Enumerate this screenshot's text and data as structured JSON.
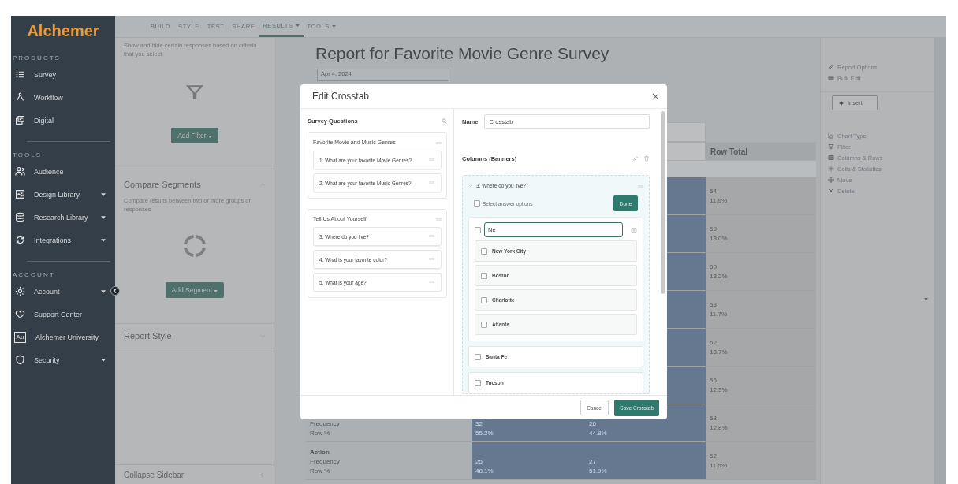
{
  "sidebar": {
    "logo": "Alchemer",
    "sections": [
      {
        "title": "PRODUCTS",
        "items": [
          {
            "label": "Survey",
            "kind": "list",
            "has_menu": false
          },
          {
            "label": "Workflow",
            "kind": "nodes",
            "has_menu": false
          },
          {
            "label": "Digital",
            "kind": "windows",
            "has_menu": false
          }
        ]
      },
      {
        "title": "TOOLS",
        "items": [
          {
            "label": "Audience",
            "kind": "people",
            "has_menu": false
          },
          {
            "label": "Design Library",
            "kind": "image",
            "has_menu": true
          },
          {
            "label": "Research Library",
            "kind": "database",
            "has_menu": true
          },
          {
            "label": "Integrations",
            "kind": "sync",
            "has_menu": true
          }
        ]
      },
      {
        "title": "ACCOUNT",
        "items": [
          {
            "label": "Account",
            "kind": "gear",
            "has_menu": true
          },
          {
            "label": "Support Center",
            "kind": "heart",
            "has_menu": false
          },
          {
            "label": "Alchemer University",
            "kind": "badge",
            "badge": "Au",
            "has_menu": false
          },
          {
            "label": "Security",
            "kind": "shield",
            "has_menu": true
          }
        ]
      }
    ]
  },
  "nav": {
    "tabs": [
      {
        "label": "BUILD",
        "selected": false,
        "has_menu": false
      },
      {
        "label": "STYLE",
        "selected": false,
        "has_menu": false
      },
      {
        "label": "TEST",
        "selected": false,
        "has_menu": false
      },
      {
        "label": "SHARE",
        "selected": false,
        "has_menu": false
      },
      {
        "label": "RESULTS",
        "selected": true,
        "has_menu": true
      },
      {
        "label": "TOOLS",
        "selected": false,
        "has_menu": true
      }
    ]
  },
  "left_panel": {
    "filter_text": "Show and hide certain responses based on criteria that you select.",
    "filter_button": "Add Filter",
    "segments_title": "Compare Segments",
    "segments_text": "Compare results between two or more groups of responses",
    "segment_button": "Add Segment",
    "style_title": "Report Style",
    "collapse": "Collapse Sidebar"
  },
  "report": {
    "title": "Report for Favorite Movie Genre Survey",
    "date": "Apr 4, 2024",
    "table": {
      "total_header": "Row Total",
      "rows": [
        {
          "total": [
            "54",
            "11.9%"
          ]
        },
        {
          "total": [
            "59",
            "13.0%"
          ]
        },
        {
          "total": [
            "60",
            "13.2%"
          ]
        },
        {
          "total": [
            "53",
            "11.7%"
          ]
        },
        {
          "total": [
            "62",
            "13.7%"
          ]
        },
        {
          "total": [
            "56",
            "12.3%"
          ]
        },
        {
          "label": [
            "Frequency",
            "Row %"
          ],
          "values": [
            [
              "32",
              "55.2%"
            ],
            [
              "26",
              "44.8%"
            ]
          ],
          "total": [
            "58",
            "12.8%"
          ]
        },
        {
          "label": [
            "Action",
            "Frequency",
            "Row %"
          ],
          "values": [
            [
              "25",
              "48.1%"
            ],
            [
              "27",
              "51.9%"
            ]
          ],
          "total": [
            "52",
            "11.5%"
          ]
        }
      ]
    }
  },
  "right_panel": {
    "links": [
      {
        "label": "Report Options",
        "kind": "pencil"
      },
      {
        "label": "Bulk Edit",
        "kind": "grid"
      }
    ],
    "insert": "Insert",
    "tools": [
      {
        "label": "Chart Type",
        "kind": "chart"
      },
      {
        "label": "Filter",
        "kind": "filter"
      },
      {
        "label": "Columns & Rows",
        "kind": "grid"
      },
      {
        "label": "Cells & Statistics",
        "kind": "gear"
      },
      {
        "label": "Move",
        "kind": "move"
      },
      {
        "label": "Delete",
        "kind": "x"
      }
    ]
  },
  "modal": {
    "title": "Edit Crosstab",
    "questions_title": "Survey Questions",
    "groups": [
      {
        "title": "Favorite Movie and Music Genres",
        "questions": [
          "1. What are your favorite Movie Genres?",
          "2. What are your favorite Music Genres?"
        ]
      },
      {
        "title": "Tell Us About Yourself",
        "questions": [
          "3. Where do you live?",
          "4. What is your favorite color?",
          "5. What is your age?"
        ]
      }
    ],
    "name_label": "Name",
    "name_value": "Crosstab",
    "columns_title": "Columns (Banners)",
    "banner": {
      "question": "3. Where do you live?",
      "expanded": true,
      "select_label": "Select answer options",
      "select_checked": false,
      "done": "Done",
      "search_value": "Ne",
      "search_checked": false,
      "matches": [
        {
          "label": "New York City",
          "checked": false
        },
        {
          "label": "Boston",
          "checked": false
        },
        {
          "label": "Charlotte",
          "checked": false
        },
        {
          "label": "Atlanta",
          "checked": false
        }
      ],
      "others": [
        {
          "label": "Santa Fe",
          "checked": false
        },
        {
          "label": "Tucson",
          "checked": false
        }
      ]
    },
    "cancel": "Cancel",
    "save": "Save Crosstab"
  }
}
